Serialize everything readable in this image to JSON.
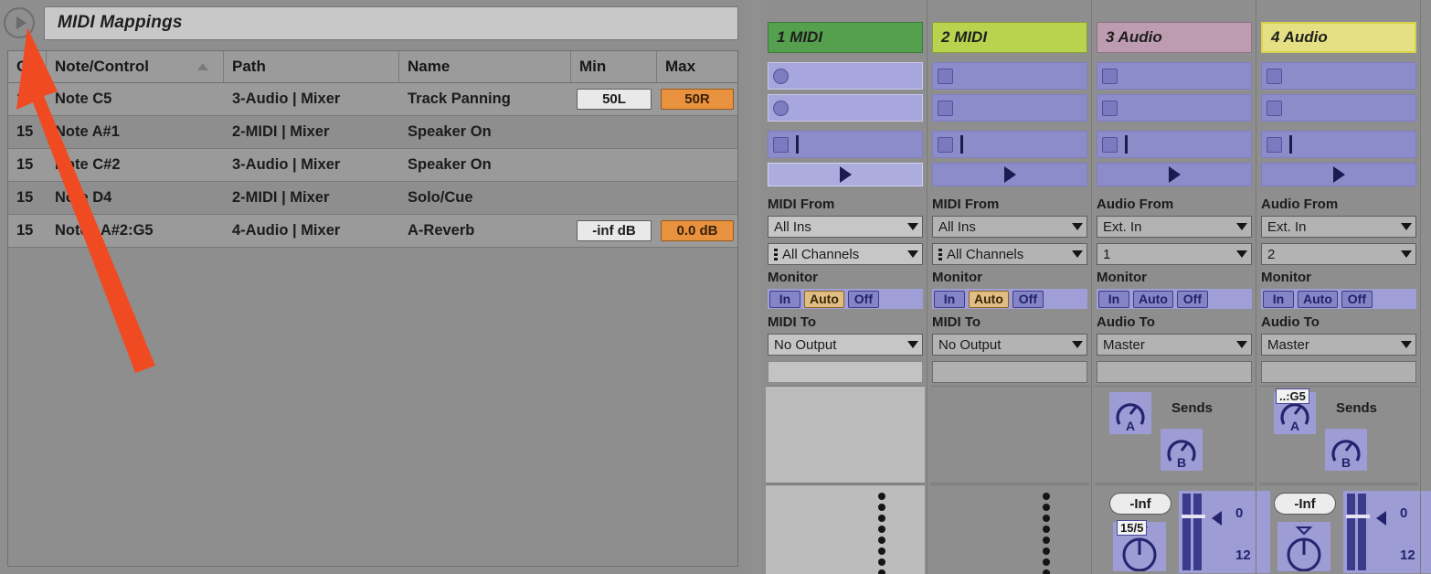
{
  "midi_mappings": {
    "disclosure_icon": "triangle-right-icon",
    "title": "MIDI Mappings",
    "columns": [
      {
        "key": "channel",
        "label": "Channel"
      },
      {
        "key": "note",
        "label": "Note/Control",
        "sorted": true,
        "sort_icon": "sort-ascending-icon"
      },
      {
        "key": "path",
        "label": "Path"
      },
      {
        "key": "name",
        "label": "Name"
      },
      {
        "key": "min",
        "label": "Min"
      },
      {
        "key": "max",
        "label": "Max"
      }
    ],
    "column_short_labels": {
      "channel": "C",
      "note": "Note/Control",
      "path": "Path",
      "name": "Name",
      "min": "Min",
      "max": "Max"
    },
    "rows": [
      {
        "channel": "15",
        "note": "Note C5",
        "path": "3-Audio | Mixer",
        "name": "Track Panning",
        "min": "50L",
        "max": "50R"
      },
      {
        "channel": "15",
        "note": "Note A#1",
        "path": "2-MIDI | Mixer",
        "name": "Speaker On",
        "min": "",
        "max": ""
      },
      {
        "channel": "15",
        "note": "Note C#2",
        "path": "3-Audio | Mixer",
        "name": "Speaker On",
        "min": "",
        "max": ""
      },
      {
        "channel": "15",
        "note": "Note D4",
        "path": "2-MIDI | Mixer",
        "name": "Solo/Cue",
        "min": "",
        "max": ""
      },
      {
        "channel": "15",
        "note": "Notes A#2:G5",
        "path": "4-Audio | Mixer",
        "name": "A-Reverb",
        "min": "-inf dB",
        "max": "0.0 dB"
      }
    ]
  },
  "annotation": {
    "arrow_color": "#f04a23",
    "points_at": "disclosure-triangle"
  },
  "session": {
    "tracks": [
      {
        "title": "1 MIDI",
        "color": "#55a04f",
        "selected": false,
        "type": "midi",
        "slot_icon": "record-circle-icon",
        "highlighted": true,
        "io": {
          "from_label": "MIDI From",
          "from_value": "All Ins",
          "channel_value": "All Channels",
          "channel_icon": "midi-plug-icon",
          "monitor_label": "Monitor",
          "monitor_options": [
            "In",
            "Auto",
            "Off"
          ],
          "monitor_active": "Auto",
          "to_label": "MIDI To",
          "to_value": "No Output"
        },
        "sends": {
          "visible": false,
          "label": "Sends",
          "knobs": []
        },
        "mixer": {
          "volume_display": "",
          "pan_badge": "",
          "has_fader": false,
          "dots": 8
        }
      },
      {
        "title": "2 MIDI",
        "color": "#b9d34f",
        "selected": false,
        "type": "midi",
        "slot_icon": "clip-square-icon",
        "highlighted": false,
        "io": {
          "from_label": "MIDI From",
          "from_value": "All Ins",
          "channel_value": "All Channels",
          "channel_icon": "midi-plug-icon",
          "monitor_label": "Monitor",
          "monitor_options": [
            "In",
            "Auto",
            "Off"
          ],
          "monitor_active": "Auto",
          "to_label": "MIDI To",
          "to_value": "No Output"
        },
        "sends": {
          "visible": false,
          "label": "Sends",
          "knobs": []
        },
        "mixer": {
          "volume_display": "",
          "pan_badge": "",
          "has_fader": false,
          "dots": 8
        }
      },
      {
        "title": "3 Audio",
        "color": "#bd9bb0",
        "selected": false,
        "type": "audio",
        "slot_icon": "clip-square-icon",
        "highlighted": false,
        "io": {
          "from_label": "Audio From",
          "from_value": "Ext. In",
          "channel_value": "1",
          "channel_icon": "",
          "monitor_label": "Monitor",
          "monitor_options": [
            "In",
            "Auto",
            "Off"
          ],
          "monitor_active": "",
          "to_label": "Audio To",
          "to_value": "Master"
        },
        "sends": {
          "visible": true,
          "label": "Sends",
          "knobs": [
            {
              "letter": "A",
              "badge": ""
            },
            {
              "letter": "B",
              "badge": ""
            }
          ]
        },
        "mixer": {
          "volume_display": "-Inf",
          "pan_badge": "15/5",
          "has_fader": true,
          "fader_scale": [
            "0",
            "12"
          ],
          "dots": 0
        }
      },
      {
        "title": "4 Audio",
        "color": "#e4e083",
        "selected": true,
        "type": "audio",
        "slot_icon": "clip-square-icon",
        "highlighted": false,
        "io": {
          "from_label": "Audio From",
          "from_value": "Ext. In",
          "channel_value": "2",
          "channel_icon": "",
          "monitor_label": "Monitor",
          "monitor_options": [
            "In",
            "Auto",
            "Off"
          ],
          "monitor_active": "",
          "to_label": "Audio To",
          "to_value": "Master"
        },
        "sends": {
          "visible": true,
          "label": "Sends",
          "knobs": [
            {
              "letter": "A",
              "badge": "..:G5"
            },
            {
              "letter": "B",
              "badge": ""
            }
          ]
        },
        "mixer": {
          "volume_display": "-Inf",
          "pan_badge": "",
          "has_fader": true,
          "fader_scale": [
            "0",
            "12"
          ],
          "dots": 0
        }
      }
    ],
    "scene_play_icon": "play-triangle-icon",
    "clip_rows": 2,
    "stop_row_icon": "stop-clip-icon"
  }
}
